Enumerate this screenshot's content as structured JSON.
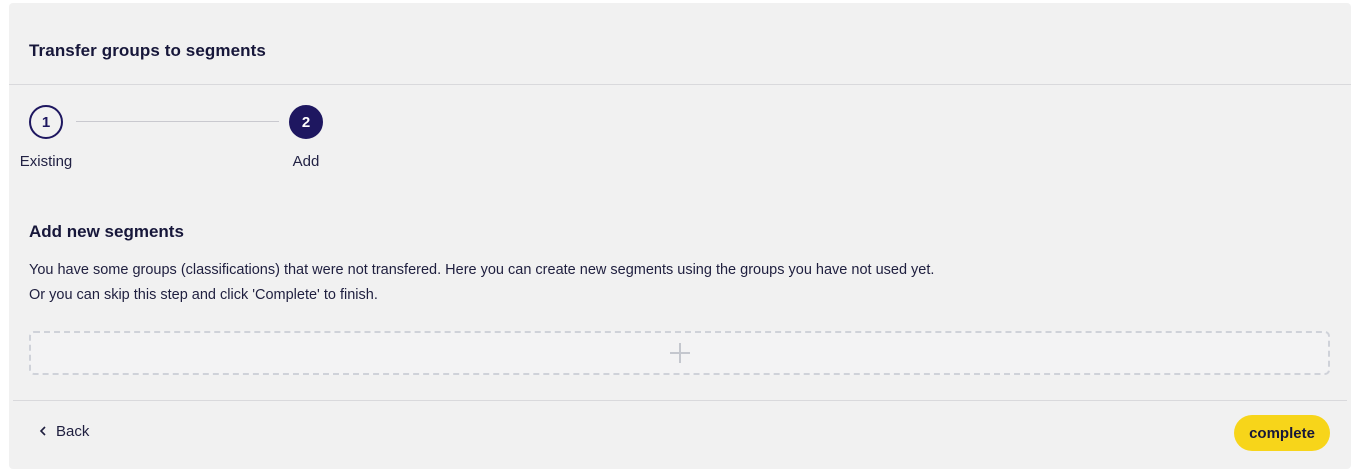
{
  "header": {
    "title": "Transfer groups to segments"
  },
  "stepper": {
    "steps": [
      {
        "number": "1",
        "label": "Existing",
        "state": "completed"
      },
      {
        "number": "2",
        "label": "Add",
        "state": "active"
      }
    ]
  },
  "section": {
    "title": "Add new segments",
    "description_line1": "You have some groups (classifications) that were not transfered. Here you can create new segments using the groups you have not used yet.",
    "description_line2": "Or you can skip this step and click 'Complete' to finish."
  },
  "add_zone": {
    "icon": "plus-icon"
  },
  "footer": {
    "back_label": "Back",
    "back_icon": "chevron-left-icon",
    "complete_label": "complete"
  },
  "colors": {
    "primary": "#1e1760",
    "accent": "#f7d51a",
    "panel_bg": "#f1f1f1"
  }
}
